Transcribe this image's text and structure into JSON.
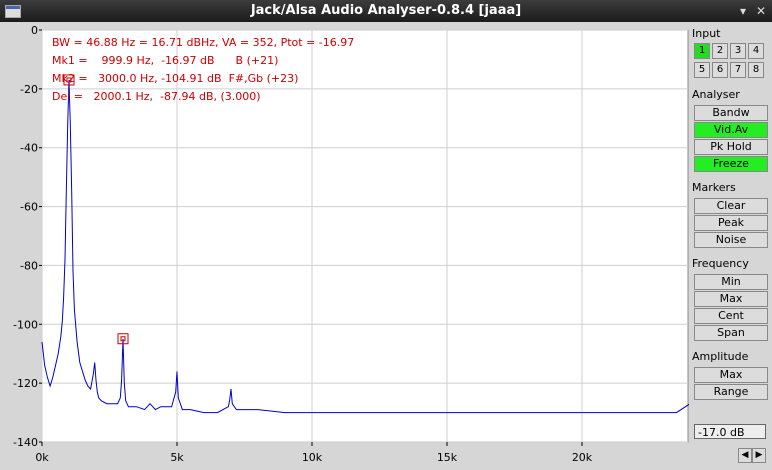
{
  "window": {
    "title": "Jack/Alsa Audio Analyser-0.8.4  [jaaa]",
    "minimize": "▾",
    "close": "✕"
  },
  "readout": {
    "line1": "BW = 46.88 Hz = 16.71 dBHz, VA = 352, Ptot = -16.97",
    "line2": "Mk1 =    999.9 Hz,  -16.97 dB      B (+21)",
    "line3": "Mk2 =   3000.0 Hz, -104.91 dB  F#,Gb (+23)",
    "line4": "Del =   2000.1 Hz,  -87.94 dB, (3.000)"
  },
  "chart_data": {
    "type": "line",
    "xlim": [
      0,
      24000
    ],
    "ylim": [
      -140,
      0
    ],
    "x_ticks": [
      "0k",
      "5k",
      "10k",
      "15k",
      "20k"
    ],
    "y_ticks": [
      "0",
      "-20",
      "-40",
      "-60",
      "-80",
      "-100",
      "-120",
      "-140"
    ],
    "grid": true,
    "series": [
      {
        "color": "#0000cc",
        "x": [
          0,
          100,
          200,
          300,
          400,
          500,
          600,
          700,
          750,
          800,
          850,
          900,
          950,
          1000,
          1050,
          1100,
          1150,
          1200,
          1300,
          1400,
          1500,
          1600,
          1700,
          1800,
          1900,
          1950,
          2000,
          2050,
          2100,
          2200,
          2400,
          2600,
          2800,
          2900,
          2950,
          3000,
          3050,
          3100,
          3200,
          3500,
          3800,
          4000,
          4200,
          4400,
          4600,
          4800,
          4950,
          5000,
          5050,
          5200,
          5500,
          6000,
          6500,
          6900,
          6950,
          7000,
          7050,
          7200,
          8000,
          9000,
          10000,
          11000,
          12000,
          13000,
          14000,
          15000,
          16000,
          17000,
          18000,
          19000,
          20000,
          21000,
          22000,
          23000,
          23500,
          24000
        ],
        "y": [
          -106,
          -114,
          -118,
          -121,
          -118,
          -114,
          -110,
          -104,
          -99,
          -91,
          -78,
          -55,
          -32,
          -17,
          -32,
          -55,
          -82,
          -95,
          -106,
          -113,
          -116,
          -119,
          -121,
          -122,
          -117,
          -113,
          -119,
          -123,
          -125,
          -126,
          -127,
          -127,
          -127,
          -125,
          -119,
          -105,
          -120,
          -126,
          -128,
          -128,
          -129,
          -127,
          -129,
          -128,
          -128,
          -128,
          -123,
          -116,
          -125,
          -129,
          -129,
          -130,
          -130,
          -128,
          -126,
          -122,
          -127,
          -129,
          -129,
          -130,
          -130,
          -130,
          -130,
          -130,
          -130,
          -130,
          -130,
          -130,
          -130,
          -130,
          -130,
          -130,
          -130,
          -130,
          -130,
          -127
        ]
      }
    ],
    "markers": [
      {
        "label": "Mk1",
        "x": 999.9,
        "y": -16.97,
        "color": "#cc0000"
      },
      {
        "label": "Mk2",
        "x": 3000.0,
        "y": -104.91,
        "color": "#cc0000"
      }
    ]
  },
  "panel": {
    "input": {
      "label": "Input",
      "channels": [
        {
          "label": "1",
          "active": true
        },
        {
          "label": "2",
          "active": false
        },
        {
          "label": "3",
          "active": false
        },
        {
          "label": "4",
          "active": false
        },
        {
          "label": "5",
          "active": false
        },
        {
          "label": "6",
          "active": false
        },
        {
          "label": "7",
          "active": false
        },
        {
          "label": "8",
          "active": false
        }
      ]
    },
    "analyser": {
      "label": "Analyser",
      "bandw": "Bandw",
      "vidav": "Vid.Av",
      "pkhold": "Pk Hold",
      "freeze": "Freeze"
    },
    "markers": {
      "label": "Markers",
      "clear": "Clear",
      "peak": "Peak",
      "noise": "Noise"
    },
    "frequency": {
      "label": "Frequency",
      "min": "Min",
      "max": "Max",
      "cent": "Cent",
      "span": "Span"
    },
    "amplitude": {
      "label": "Amplitude",
      "max": "Max",
      "range": "Range",
      "value": "-17.0 dB"
    }
  },
  "colors": {
    "accent_on": "#22ee22",
    "trace": "#0000cc",
    "marker": "#cc0000"
  }
}
